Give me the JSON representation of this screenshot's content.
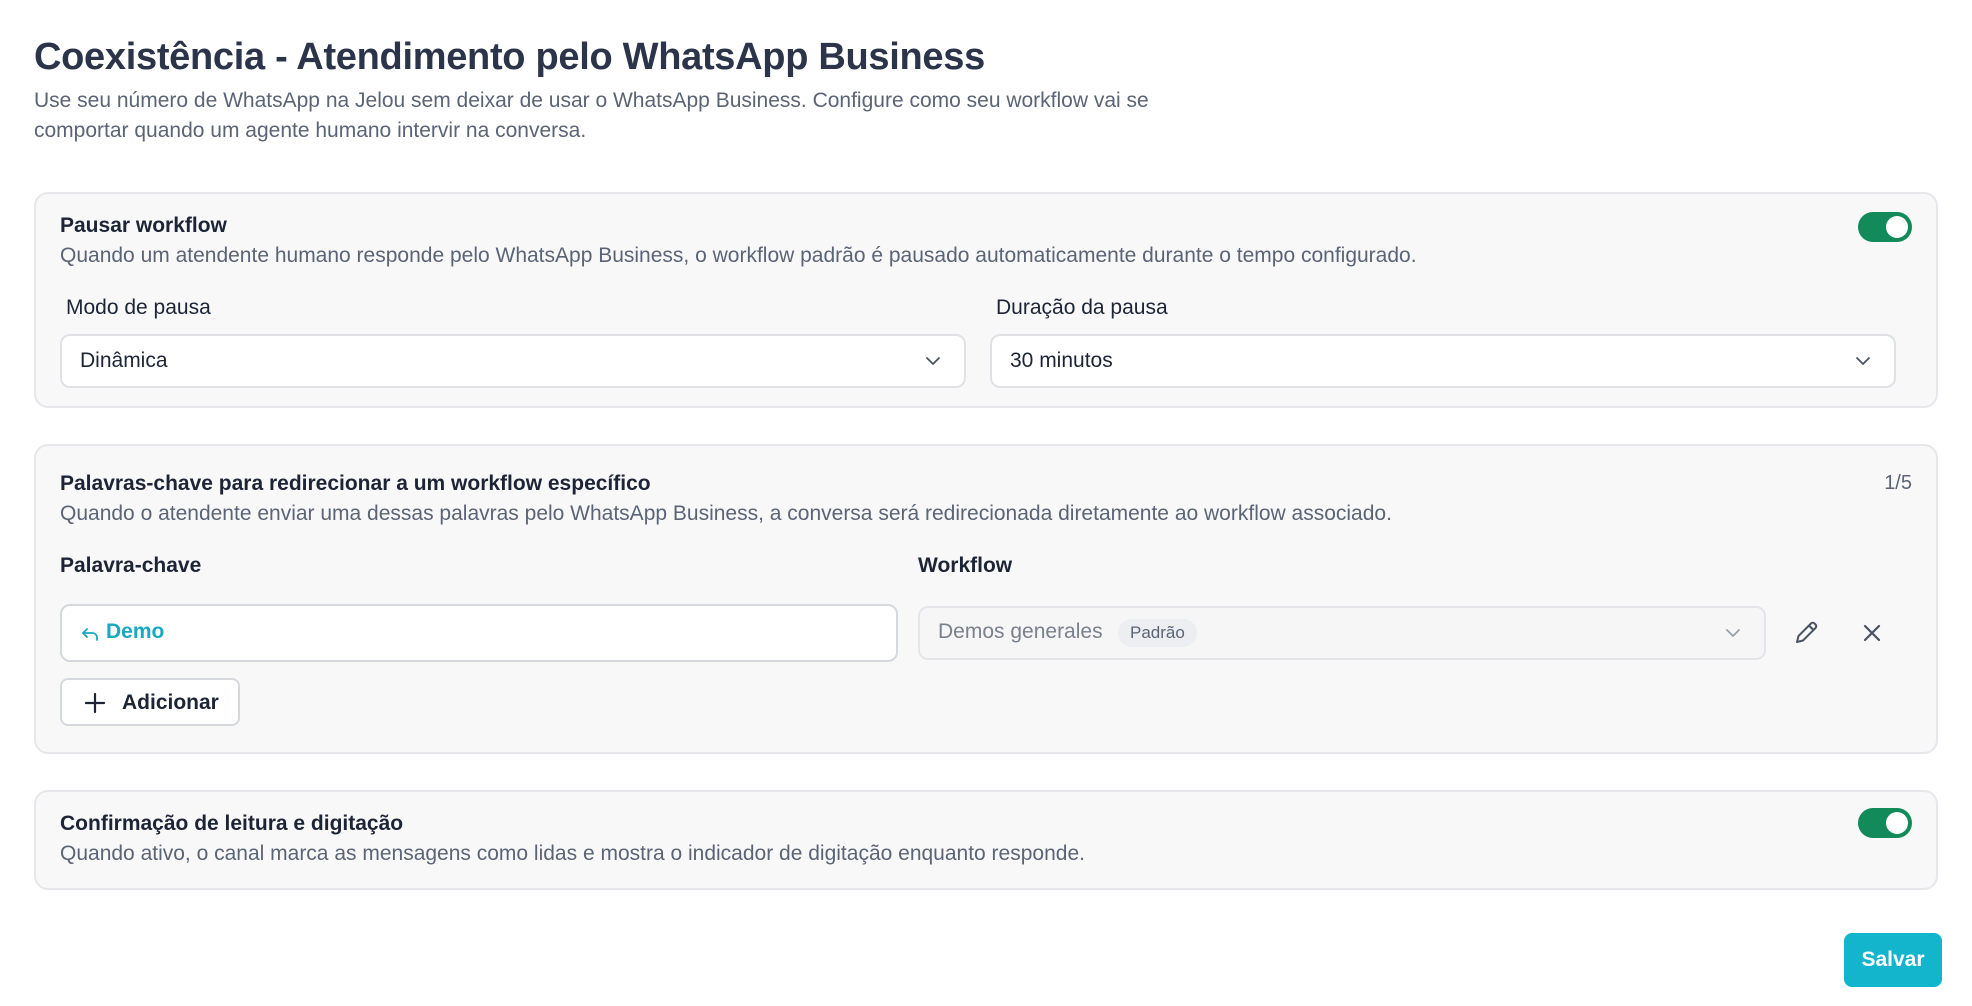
{
  "header": {
    "title": "Coexistência - Atendimento pelo WhatsApp Business",
    "subtitle": "Use seu número de WhatsApp na Jelou sem deixar de usar o WhatsApp Business. Configure como seu workflow vai se comportar quando um agente humano intervir na conversa."
  },
  "pause_section": {
    "title": "Pausar workflow",
    "description": "Quando um atendente humano responde pelo WhatsApp Business, o workflow padrão é pausado automaticamente durante o tempo configurado.",
    "enabled": true,
    "mode_label": "Modo de pausa",
    "mode_value": "Dinâmica",
    "duration_label": "Duração da pausa",
    "duration_value": "30 minutos"
  },
  "keywords_section": {
    "title": "Palavras-chave para redirecionar a um workflow específico",
    "counter": "1/5",
    "description": "Quando o atendente enviar uma dessas palavras pelo WhatsApp Business, a conversa será redirecionada diretamente ao workflow associado.",
    "keyword_column": "Palavra-chave",
    "workflow_column": "Workflow",
    "rows": [
      {
        "keyword": "Demo",
        "workflow": "Demos generales",
        "badge": "Padrão"
      }
    ],
    "add_label": "Adicionar"
  },
  "read_receipt_section": {
    "title": "Confirmação de leitura e digitação",
    "description": "Quando ativo, o canal marca as mensagens como lidas e mostra o indicador de digitação enquanto responde.",
    "enabled": true
  },
  "footer": {
    "save_label": "Salvar"
  },
  "colors": {
    "toggle_on": "#138a5a",
    "accent": "#13b5cd",
    "keyword_text": "#1aa8c0"
  },
  "icons": {
    "select_chevron": "chevron-down-icon",
    "keyword_prefix": "reply-icon",
    "edit": "pencil-icon",
    "remove": "close-icon",
    "add": "plus-icon"
  }
}
